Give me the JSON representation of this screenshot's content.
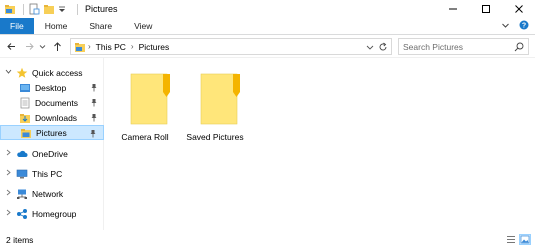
{
  "window": {
    "title": "Pictures"
  },
  "ribbon": {
    "tabs": [
      {
        "label": "File"
      },
      {
        "label": "Home"
      },
      {
        "label": "Share"
      },
      {
        "label": "View"
      }
    ]
  },
  "address": {
    "crumbs": [
      "This PC",
      "Pictures"
    ],
    "search_placeholder": "Search Pictures"
  },
  "nav": {
    "items": [
      {
        "label": "Quick access"
      },
      {
        "label": "Desktop"
      },
      {
        "label": "Documents"
      },
      {
        "label": "Downloads"
      },
      {
        "label": "Pictures"
      },
      {
        "label": "OneDrive"
      },
      {
        "label": "This PC"
      },
      {
        "label": "Network"
      },
      {
        "label": "Homegroup"
      }
    ]
  },
  "content": {
    "folders": [
      {
        "label": "Camera Roll"
      },
      {
        "label": "Saved Pictures"
      }
    ]
  },
  "status": {
    "item_count": "2 items"
  },
  "colors": {
    "accent": "#1979ca",
    "selection_bg": "#cce8ff",
    "selection_border": "#99d1ff",
    "folder_yellow": "#ffe67a",
    "folder_tab": "#f4b400"
  }
}
